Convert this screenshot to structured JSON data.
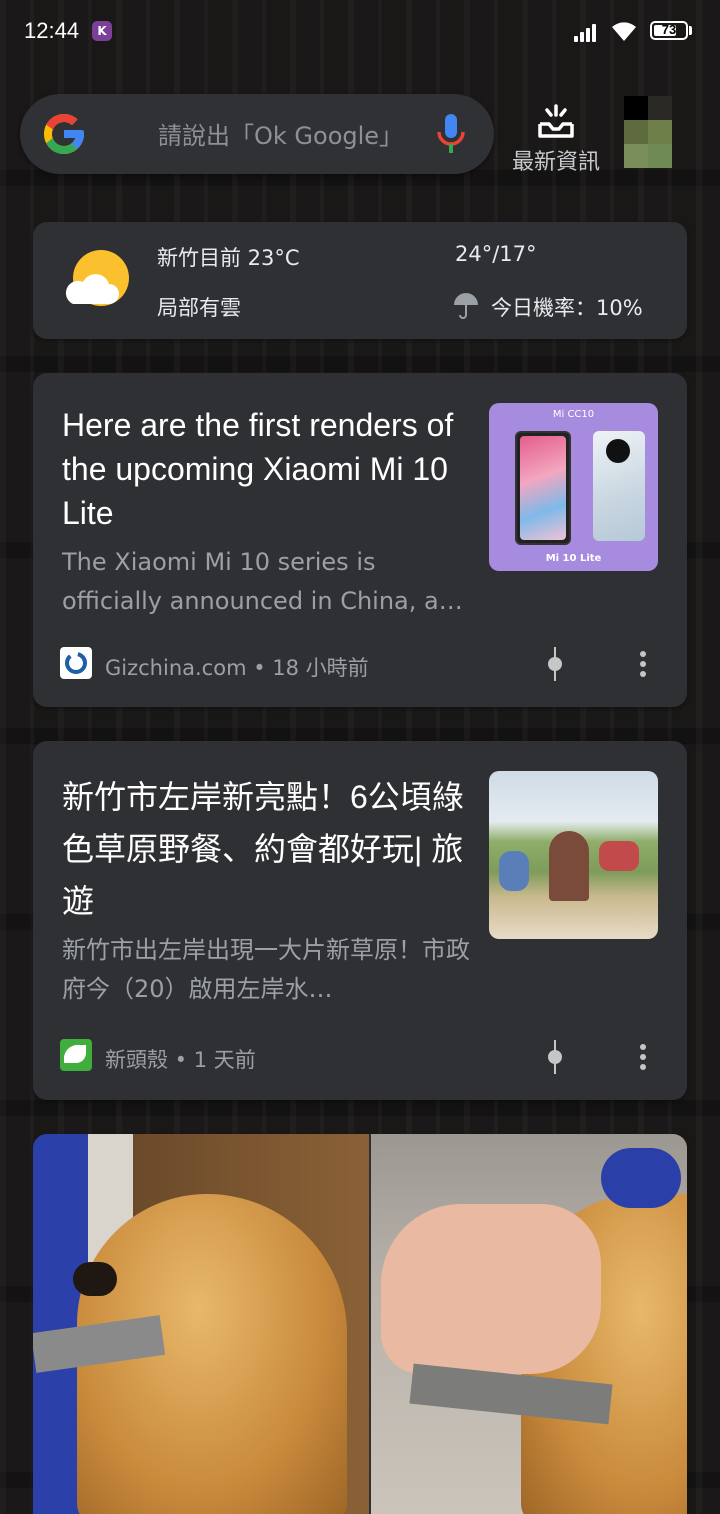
{
  "status_bar": {
    "time": "12:44",
    "app_badge": "K",
    "battery": "73"
  },
  "search": {
    "placeholder": "請說出「Ok Google」"
  },
  "header": {
    "news_label": "最新資訊"
  },
  "weather": {
    "location_temp": "新竹目前 23°C",
    "condition": "局部有雲",
    "high_low": "24°/17°",
    "rain_chance": "今日機率：10%"
  },
  "articles": [
    {
      "title": "Here are the first renders of the upcoming Xiaomi Mi 10 Lite",
      "snippet": "The Xiaomi Mi 10 series is officially announced in China, a…",
      "source": "Gizchina.com • 18 小時前",
      "thumb_top": "Mi CC10",
      "thumb_bottom": "Mi 10 Lite"
    },
    {
      "title": "新竹市左岸新亮點！6公頃綠色草原野餐、約會都好玩| 旅遊",
      "snippet": "新竹市出左岸出現一大片新草原！市政府今（20）啟用左岸水…",
      "source": "新頭殼 • 1 天前"
    }
  ],
  "colors": {
    "card_bg": "#2f3033",
    "google_blue": "#4285F4",
    "google_red": "#EA4335",
    "google_yellow": "#FBBC05",
    "google_green": "#34A853",
    "thumb_purple": "#a78bdf"
  }
}
